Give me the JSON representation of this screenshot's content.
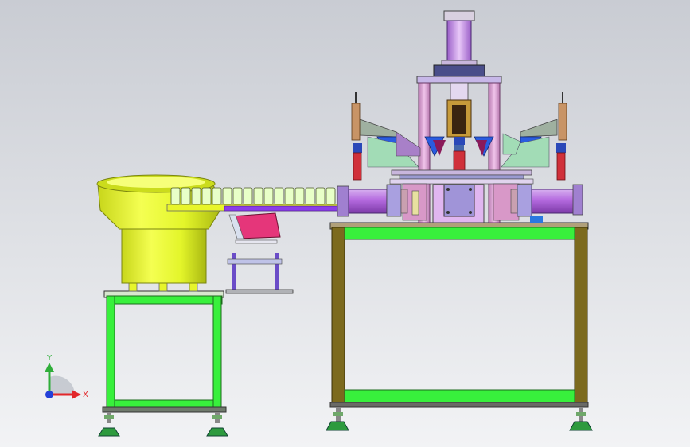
{
  "viewport": {
    "background_top": "#c9ccd3",
    "background_bottom": "#f2f3f5"
  },
  "triad": {
    "y_label": "Y",
    "x_label": "X",
    "colors": {
      "y": "#2fae3a",
      "x": "#e2262a",
      "z": "#2440d8"
    }
  },
  "palette": {
    "frame_green": "#38f03c",
    "frame_brown": "#7c6a1e",
    "bowl_yellow": "#e9ff2a",
    "pillar_pink": "#d99ad2",
    "cylinder_purple": "#b46adf",
    "plate_lilac": "#a9a0e0",
    "chute_magenta": "#e5367a",
    "red_actuator": "#d0303a",
    "blue_hopper": "#2a5ce0",
    "track_violet": "#8a3ee8"
  }
}
